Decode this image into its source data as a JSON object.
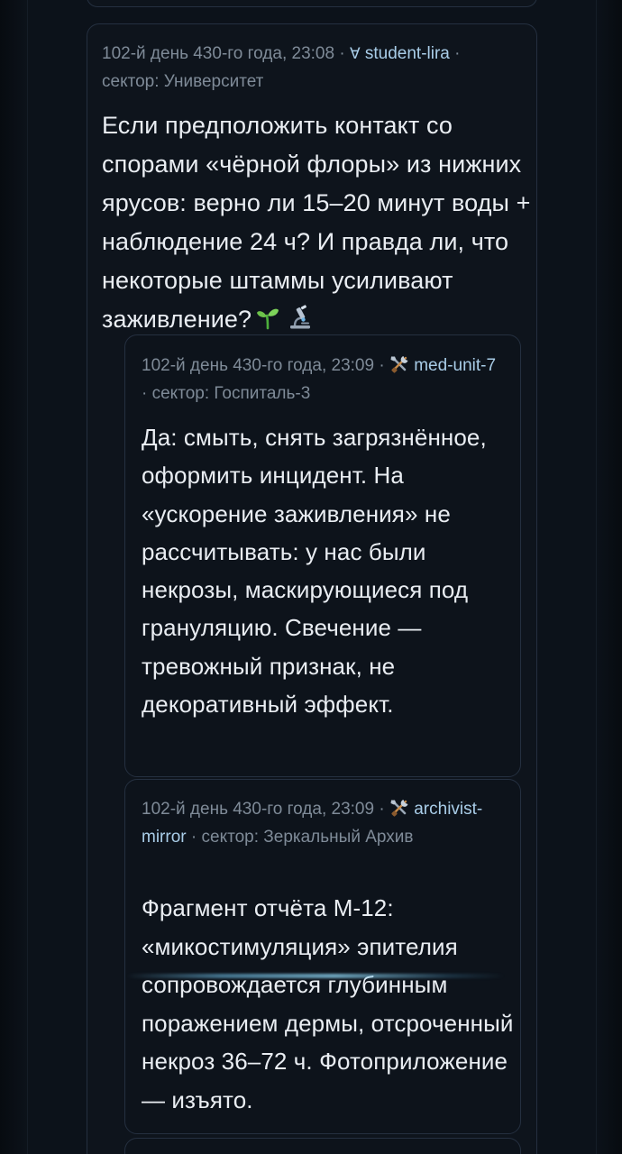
{
  "thread": {
    "post": {
      "timestamp": "102-й день 430-го года, 23:08",
      "separator": "·",
      "author_glyph": "∀",
      "author": "student-lira",
      "sector": "сектор: Университет",
      "text": "Если предположить контакт со спорами «чёрной флоры» из нижних ярусов: верно ли 15–20 минут воды + наблюдение 24 ч? И правда ли, что некоторые штаммы усиливают заживление?",
      "emoji": [
        "seedling-icon",
        "microscope-icon"
      ]
    },
    "replies": [
      {
        "timestamp": "102-й день 430-го года, 23:09",
        "separator": "·",
        "author_icon": "tools-icon",
        "author": "med-unit-7",
        "sector": "сектор: Госпиталь-3",
        "text": "Да: смыть, снять загрязнённое, оформить инцидент. На «ускорение заживления» не рассчитывать: у нас были некрозы, маскирующиеся под грануляцию. Свечение — тревожный признак, не декоративный эффект."
      },
      {
        "timestamp": "102-й день 430-го года, 23:09",
        "separator": "·",
        "author_icon": "tools-icon",
        "author": "archivist-mirror",
        "sector": "сектор: Зеркальный Архив",
        "text": "Фрагмент отчёта М-12: «микостимуляция» эпителия сопровождается глубинным поражением дермы, отсроченный некроз 36–72 ч. Фотоприложение — изъято."
      }
    ]
  },
  "colors": {
    "background": "#0c121a",
    "card": "#0e141c",
    "card_border": "#253040",
    "meta_text": "#7f8b98",
    "author_link": "#a9cde8",
    "body_text": "#e9edf2",
    "glow": "#8cd2f0"
  }
}
